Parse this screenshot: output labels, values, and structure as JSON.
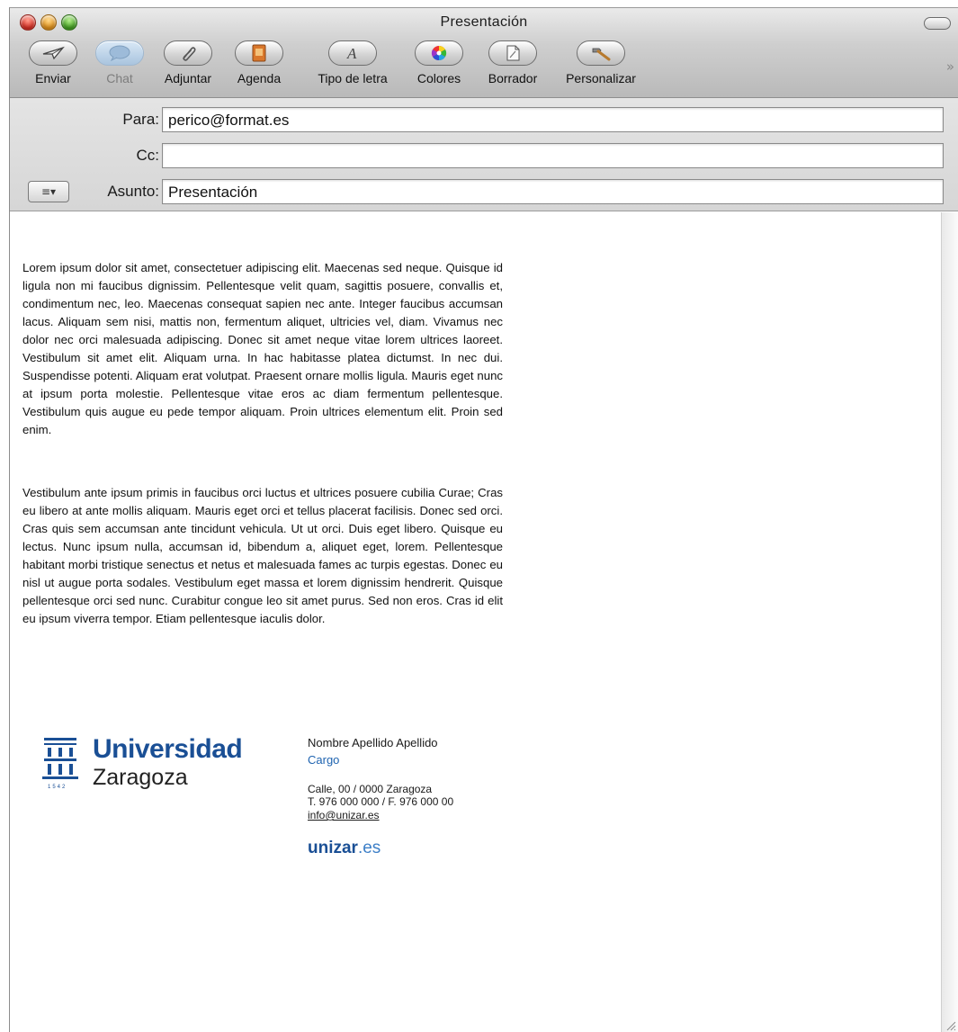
{
  "window": {
    "title": "Presentación"
  },
  "toolbar": {
    "items": [
      {
        "label": "Enviar",
        "icon": "send-icon",
        "enabled": true
      },
      {
        "label": "Chat",
        "icon": "chat-icon",
        "enabled": false
      },
      {
        "label": "Adjuntar",
        "icon": "paperclip-icon",
        "enabled": true
      },
      {
        "label": "Agenda",
        "icon": "address-book-icon",
        "enabled": true
      },
      {
        "label": "Tipo de letra",
        "icon": "font-icon",
        "enabled": true
      },
      {
        "label": "Colores",
        "icon": "color-wheel-icon",
        "enabled": true
      },
      {
        "label": "Borrador",
        "icon": "draft-icon",
        "enabled": true
      },
      {
        "label": "Personalizar",
        "icon": "hammer-icon",
        "enabled": true
      }
    ],
    "overflow": "»"
  },
  "headers": {
    "to_label": "Para:",
    "to_value": "perico@format.es",
    "cc_label": "Cc:",
    "cc_value": "",
    "subject_label": "Asunto:",
    "subject_value": "Presentación",
    "menu_glyph": "≡▾"
  },
  "message": {
    "paragraph1": "Lorem ipsum dolor sit amet, consectetuer adipiscing elit. Maecenas sed neque. Quisque id ligula non mi faucibus dignissim. Pellentesque velit quam, sagittis posuere, convallis et, condimentum nec, leo. Maecenas consequat sapien nec ante. Integer faucibus accumsan lacus. Aliquam sem nisi, mattis non, fermentum aliquet, ultricies vel, diam. Vivamus nec dolor nec orci malesuada adipiscing. Donec sit amet neque vitae lorem ultrices laoreet. Vestibulum sit amet elit. Aliquam urna. In hac habitasse platea dictumst. In nec dui. Suspendisse potenti. Aliquam erat volutpat. Praesent ornare mollis ligula. Mauris eget nunc at ipsum porta molestie. Pellentesque vitae eros ac diam fermentum pellentesque. Vestibulum quis augue eu pede tempor aliquam. Proin ultrices elementum elit. Proin sed enim.",
    "paragraph2": "Vestibulum ante ipsum primis in faucibus orci luctus et ultrices posuere cubilia Curae; Cras eu libero at ante mollis aliquam. Mauris eget orci et tellus placerat facilisis. Donec sed orci. Cras quis sem accumsan ante tincidunt vehicula. Ut ut orci. Duis eget libero. Quisque eu lectus. Nunc ipsum nulla, accumsan id, bibendum a, aliquet eget, lorem. Pellentesque habitant morbi tristique senectus et netus et malesuada fames ac turpis egestas. Donec eu nisl ut augue porta sodales. Vestibulum eget massa et lorem dignissim hendrerit. Quisque pellentesque orci sed nunc. Curabitur congue leo sit amet purus. Sed non eros. Cras id elit eu ipsum viverra tempor. Etiam pellentesque iaculis dolor."
  },
  "signature": {
    "logo_name": "Universidad",
    "logo_city": "Zaragoza",
    "logo_year": "1542",
    "name": "Nombre Apellido Apellido",
    "cargo": "Cargo",
    "address": "Calle, 00 / 0000 Zaragoza",
    "phone": "T. 976 000 000 / F. 976 000 00",
    "email": "info@unizar.es",
    "web_strong": "unizar",
    "web_light": ".es"
  },
  "colors": {
    "brand_blue": "#1a4f95",
    "link_blue": "#1e63b0"
  }
}
